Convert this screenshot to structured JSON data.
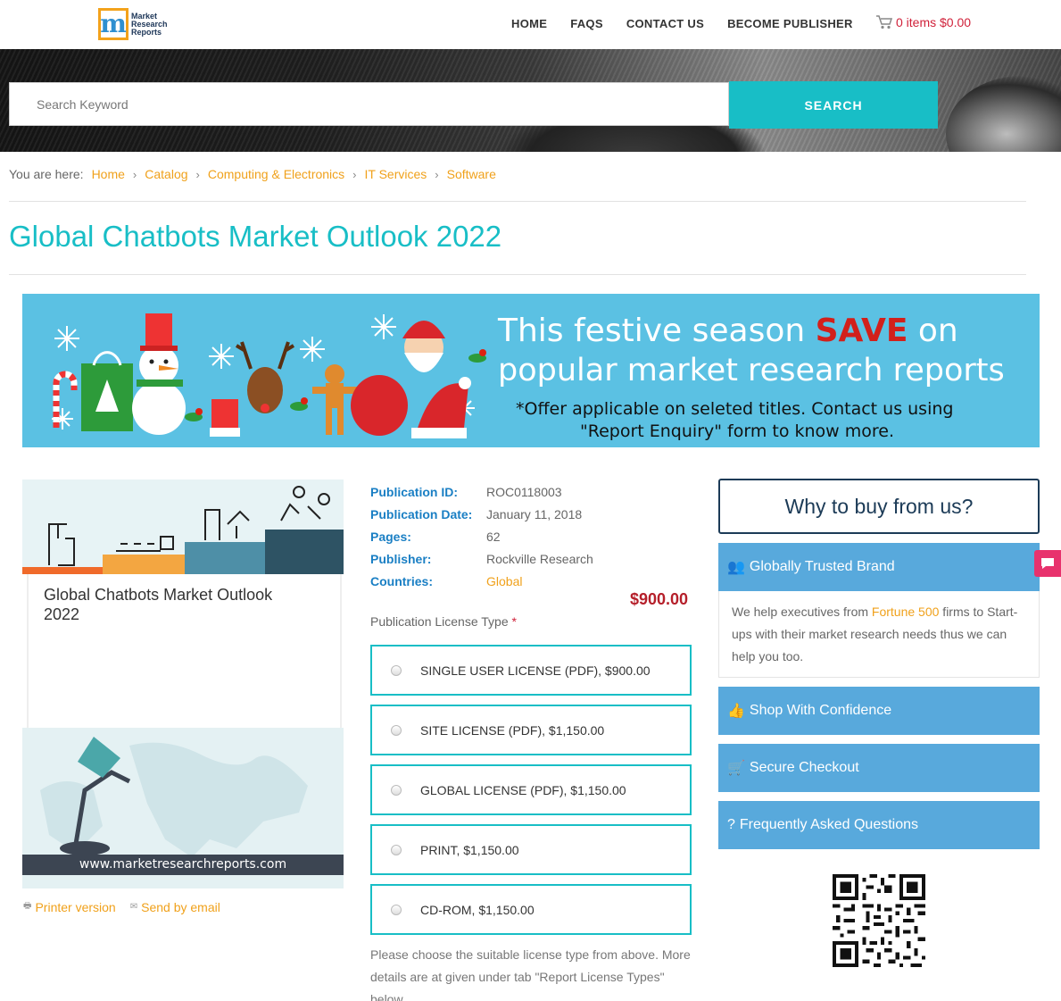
{
  "brand": {
    "logo_letter": "m",
    "logo_text_1": "Market",
    "logo_text_2": "Research",
    "logo_text_3": "Reports"
  },
  "nav": {
    "home": "HOME",
    "faqs": "FAQS",
    "contact": "CONTACT US",
    "publisher": "BECOME PUBLISHER"
  },
  "cart": {
    "label": "0 items $0.00"
  },
  "search": {
    "placeholder": "Search Keyword",
    "button": "SEARCH"
  },
  "breadcrumb": {
    "prefix": "You are here:",
    "items": [
      "Home",
      "Catalog",
      "Computing & Electronics",
      "IT Services",
      "Software"
    ]
  },
  "page": {
    "title": "Global Chatbots Market Outlook 2022"
  },
  "banner": {
    "line1_pre": "This festive season ",
    "line1_save": "SAVE",
    "line1_post": " on",
    "line2": "popular market research reports",
    "line3": "*Offer applicable on seleted titles. Contact us using",
    "line4": "\"Report Enquiry\" form to know more."
  },
  "card": {
    "title": "Global Chatbots Market Outlook 2022",
    "url": "www.marketresearchreports.com"
  },
  "links": {
    "printer": "Printer version",
    "email": "Send by email"
  },
  "details": {
    "id_label": "Publication ID:",
    "id": "ROC0118003",
    "date_label": "Publication Date:",
    "date": "January 11, 2018",
    "pages_label": "Pages:",
    "pages": "62",
    "publisher_label": "Publisher:",
    "publisher": "Rockville Research",
    "countries_label": "Countries:",
    "countries": "Global"
  },
  "price": "$900.00",
  "license": {
    "label": "Publication License Type",
    "required": "*",
    "options": [
      "SINGLE USER LICENSE (PDF), $900.00",
      "SITE LICENSE (PDF), $1,150.00",
      "GLOBAL LICENSE (PDF), $1,150.00",
      "PRINT, $1,150.00",
      "CD-ROM, $1,150.00"
    ],
    "note": "Please choose the suitable license type from above. More details are at given under tab \"Report License Types\" below."
  },
  "sidebar": {
    "why": "Why to buy from us?",
    "trusted": "Globally Trusted Brand",
    "trusted_body_pre": "We help executives from ",
    "trusted_body_hl": "Fortune 500",
    "trusted_body_post": " firms to Start-ups with their market research needs thus we can help you too.",
    "shop": "Shop With Confidence",
    "secure": "Secure Checkout",
    "faq": "Frequently Asked Questions"
  },
  "colors": {
    "accent": "#18bec6",
    "link": "#f0a11b",
    "price": "#b51f2a",
    "panel": "#58a9dc",
    "banner": "#5bc1e3"
  }
}
